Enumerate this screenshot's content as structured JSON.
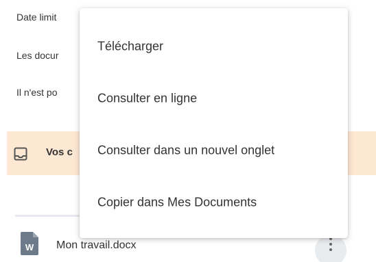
{
  "info": {
    "date_limit": "Date limit",
    "documents": "Les docur",
    "not_possible": "Il n'est po"
  },
  "banner": {
    "icon": "inbox-icon",
    "text": "Vos c",
    "background": "#fde8d3"
  },
  "file": {
    "icon": "word-document-icon",
    "name": "Mon travail.docx",
    "icon_color": "#6c7a89"
  },
  "menu": {
    "items": [
      {
        "label": "Télécharger"
      },
      {
        "label": "Consulter en ligne"
      },
      {
        "label": "Consulter dans un nouvel onglet"
      },
      {
        "label": "Copier dans Mes Documents"
      }
    ]
  },
  "kebab": {
    "icon": "more-vertical-icon"
  }
}
